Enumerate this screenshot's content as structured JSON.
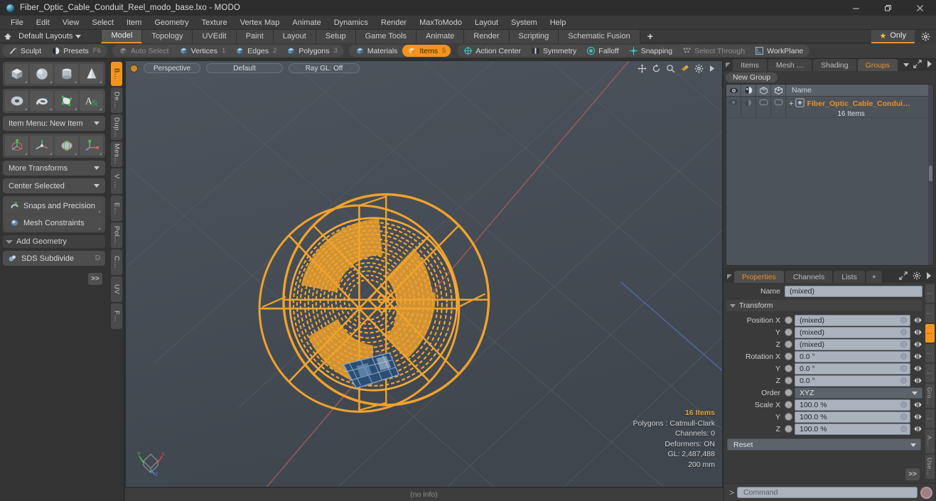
{
  "window": {
    "title": "Fiber_Optic_Cable_Conduit_Reel_modo_base.lxo - MODO",
    "app_icon": "modo-sphere-icon",
    "minimize": "minimize-icon",
    "maximize": "restore-icon",
    "close": "close-icon"
  },
  "menubar": {
    "items": [
      "File",
      "Edit",
      "View",
      "Select",
      "Item",
      "Geometry",
      "Texture",
      "Vertex Map",
      "Animate",
      "Dynamics",
      "Render",
      "MaxToModo",
      "Layout",
      "System",
      "Help"
    ]
  },
  "layoutbar": {
    "home_icon": "home-icon",
    "layouts_label": "Default Layouts",
    "tabs": [
      {
        "label": "Model",
        "active": true
      },
      {
        "label": "Topology",
        "active": false
      },
      {
        "label": "UVEdit",
        "active": false
      },
      {
        "label": "Paint",
        "active": false
      },
      {
        "label": "Layout",
        "active": false
      },
      {
        "label": "Setup",
        "active": false
      },
      {
        "label": "Game Tools",
        "active": false
      },
      {
        "label": "Animate",
        "active": false
      },
      {
        "label": "Render",
        "active": false
      },
      {
        "label": "Scripting",
        "active": false
      },
      {
        "label": "Schematic Fusion",
        "active": false
      }
    ],
    "add_label": "+",
    "only_label": "Only",
    "star_icon": "star-icon",
    "gear_icon": "gear-icon"
  },
  "modebar": {
    "group1": [
      {
        "label": "Sculpt",
        "icon": "brush-icon",
        "state": "normal",
        "num": ""
      },
      {
        "label": "Presets",
        "icon": "sphere-icon",
        "state": "normal",
        "num": "F6"
      }
    ],
    "group2": [
      {
        "label": "Auto Select",
        "icon": "cube-gray-icon",
        "state": "disabled",
        "num": ""
      },
      {
        "label": "Vertices",
        "icon": "cube-blue-icon",
        "state": "normal",
        "num": "1"
      },
      {
        "label": "Edges",
        "icon": "cube-blue-icon",
        "state": "normal",
        "num": "2"
      },
      {
        "label": "Polygons",
        "icon": "cube-blue-icon",
        "state": "normal",
        "num": "3"
      }
    ],
    "group3": [
      {
        "label": "Materials",
        "icon": "cube-blue-icon",
        "state": "normal",
        "num": ""
      },
      {
        "label": "Items",
        "icon": "cube-orange-icon",
        "state": "selected",
        "num": "5"
      }
    ],
    "group4": [
      {
        "label": "Action Center",
        "icon": "target-icon",
        "state": "normal",
        "num": ""
      },
      {
        "label": "Symmetry",
        "icon": "symmetry-icon",
        "state": "normal",
        "num": ""
      },
      {
        "label": "Falloff",
        "icon": "falloff-icon",
        "state": "normal",
        "num": ""
      },
      {
        "label": "Snapping",
        "icon": "snap-icon",
        "state": "normal",
        "num": ""
      },
      {
        "label": "Select Through",
        "icon": "selectthrough-icon",
        "state": "disabled",
        "num": ""
      },
      {
        "label": "WorkPlane",
        "icon": "workplane-icon",
        "state": "normal",
        "num": ""
      }
    ]
  },
  "leftpanel": {
    "primitives_row1": [
      "cube-primitive-icon",
      "sphere-primitive-icon",
      "cylinder-primitive-icon",
      "cone-primitive-icon"
    ],
    "primitives_row2": [
      "torus-primitive-icon",
      "spiral-primitive-icon",
      "mesh-primitive-icon",
      "text-primitive-icon"
    ],
    "item_menu": "Item Menu: New Item",
    "transform_icons": [
      "move-tool-icon",
      "rotate-tool-icon",
      "scale-tool-icon",
      "transform-tool-icon"
    ],
    "more_transforms": "More Transforms",
    "center_selected": "Center Selected",
    "snaps_and_precision": "Snaps and Precision",
    "snaps_icon": "snap-magnet-icon",
    "mesh_constraints": "Mesh Constraints",
    "mesh_constraints_icon": "constraint-icon",
    "add_geometry": "Add Geometry",
    "sds_subdivide": "SDS Subdivide",
    "sds_icon": "subdivide-icon",
    "sds_key": "D",
    "expand_label": ">>",
    "vtabs": [
      {
        "label": "B…",
        "active": true
      },
      {
        "label": "De…",
        "active": false
      },
      {
        "label": "Dup…",
        "active": false
      },
      {
        "label": "Mes…",
        "active": false
      },
      {
        "label": "V …",
        "active": false
      },
      {
        "label": "E…",
        "active": false
      },
      {
        "label": "Pol…",
        "active": false
      },
      {
        "label": "C…",
        "active": false
      },
      {
        "label": "UV",
        "active": false
      },
      {
        "label": "F…",
        "active": false
      }
    ]
  },
  "viewport": {
    "mode_dot": "viewport-options-dot",
    "perspective": "Perspective",
    "shading": "Default",
    "raygl": "Ray GL: Off",
    "header_icons": [
      "move-view-icon",
      "rotate-view-icon",
      "zoom-view-icon",
      "fit-view-icon",
      "viewport-gear-icon",
      "viewport-arrow-icon"
    ],
    "info": {
      "items": "16 Items",
      "polygons": "Polygons : Catmull-Clark",
      "channels": "Channels: 0",
      "deformers": "Deformers: ON",
      "gl": "GL: 2,487,488",
      "scale": "200 mm"
    },
    "gizmo": "axis-gizmo",
    "model_color": "#F0A22C",
    "background_color": "#454C55",
    "status": "(no info)"
  },
  "rightpanel": {
    "top_tabs": [
      {
        "label": "Items",
        "active": false
      },
      {
        "label": "Mesh …",
        "active": false
      },
      {
        "label": "Shading",
        "active": false
      },
      {
        "label": "Groups",
        "active": true
      }
    ],
    "top_tab_icons": [
      "expand-icon",
      "arrow-right-icon"
    ],
    "new_group_label": "New Group",
    "tree": {
      "col_icons": [
        "eye-icon",
        "render-icon",
        "shaded-icon",
        "wireframe-icon"
      ],
      "name_header": "Name",
      "rows": [
        {
          "name": "Fiber_Optic_Cable_Condui…",
          "sub": "16 Items",
          "icon": "group-icon",
          "expander": "+"
        }
      ]
    },
    "prop_tabs": [
      {
        "label": "Properties",
        "active": true
      },
      {
        "label": "Channels",
        "active": false
      },
      {
        "label": "Lists",
        "active": false
      },
      {
        "label": "+",
        "active": false
      }
    ],
    "prop_tab_icons": [
      "expand-icon",
      "gear-icon",
      "arrow-right-icon"
    ],
    "properties": {
      "name_label": "Name",
      "name_value": "(mixed)",
      "transform_section": "Transform",
      "fields": [
        {
          "label": "Position X",
          "value": "(mixed)",
          "type": "num"
        },
        {
          "label": "Y",
          "value": "(mixed)",
          "type": "num"
        },
        {
          "label": "Z",
          "value": "(mixed)",
          "type": "num"
        },
        {
          "label": "Rotation X",
          "value": "0.0 °",
          "type": "num"
        },
        {
          "label": "Y",
          "value": "0.0 °",
          "type": "num"
        },
        {
          "label": "Z",
          "value": "0.0 °",
          "type": "num"
        },
        {
          "label": "Order",
          "value": "XYZ",
          "type": "select"
        },
        {
          "label": "Scale X",
          "value": "100.0 %",
          "type": "num"
        },
        {
          "label": "Y",
          "value": "100.0 %",
          "type": "num"
        },
        {
          "label": "Z",
          "value": "100.0 %",
          "type": "num"
        }
      ],
      "reset_label": "Reset",
      "expand_label": ">>"
    },
    "prop_vtabs": [
      {
        "label": "",
        "active": false
      },
      {
        "label": "",
        "active": false
      },
      {
        "label": "",
        "active": true
      },
      {
        "label": "",
        "active": false
      },
      {
        "label": "",
        "active": false
      },
      {
        "label": "Gro…",
        "active": false
      },
      {
        "label": "",
        "active": false
      },
      {
        "label": "A…",
        "active": false
      },
      {
        "label": "Use…",
        "active": false
      }
    ]
  },
  "commandbar": {
    "prompt": ">",
    "placeholder": "Command",
    "record_icon": "record-icon"
  }
}
